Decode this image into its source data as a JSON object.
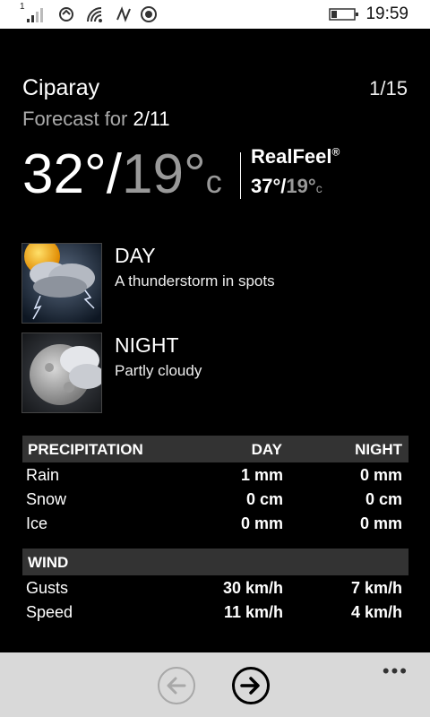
{
  "status_bar": {
    "sim_indicator": "1",
    "time": "19:59",
    "icons": [
      "signal-bars-icon",
      "data-sync-icon",
      "wifi-icon",
      "nfc-icon",
      "location-icon",
      "battery-icon"
    ]
  },
  "location": {
    "city": "Ciparay",
    "page_indicator": "1/15"
  },
  "forecast": {
    "prefix": "Forecast for ",
    "date": "2/11"
  },
  "temperature": {
    "high": "32°",
    "separator": "/",
    "low": "19°",
    "unit": "c"
  },
  "realfeel": {
    "label": "RealFeel",
    "mark": "®",
    "high": "37°",
    "separator": "/",
    "low": "19°",
    "unit": "c"
  },
  "day": {
    "title": "DAY",
    "description": "A thunderstorm in spots",
    "icon": "thunderstorm-sun-icon"
  },
  "night": {
    "title": "NIGHT",
    "description": "Partly cloudy",
    "icon": "partly-cloudy-moon-icon"
  },
  "precipitation": {
    "header": "PRECIPITATION",
    "col_day": "DAY",
    "col_night": "NIGHT",
    "rows": [
      {
        "label": "Rain",
        "day": "1 mm",
        "night": "0 mm"
      },
      {
        "label": "Snow",
        "day": "0 cm",
        "night": "0 cm"
      },
      {
        "label": "Ice",
        "day": "0 mm",
        "night": "0 mm"
      }
    ]
  },
  "wind": {
    "header": "WIND",
    "rows": [
      {
        "label": "Gusts",
        "day": "30 km/h",
        "night": "7 km/h"
      },
      {
        "label": "Speed",
        "day": "11 km/h",
        "night": "4 km/h"
      }
    ]
  },
  "app_bar": {
    "back_icon": "arrow-left-icon",
    "back_enabled": false,
    "forward_icon": "arrow-right-icon",
    "more_label": "•••"
  },
  "colors": {
    "background": "#000000",
    "section_header": "#333333",
    "muted_text": "#999999",
    "app_bar": "#d9d9d9"
  }
}
